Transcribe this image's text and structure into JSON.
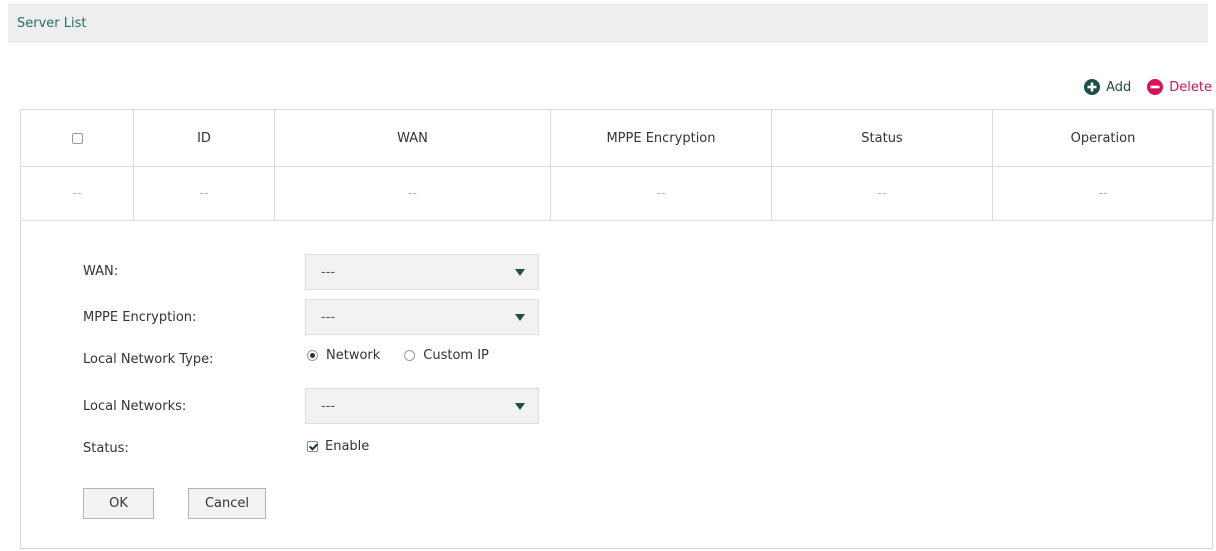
{
  "section": {
    "title": "Server List"
  },
  "toolbar": {
    "add_label": "Add",
    "delete_label": "Delete"
  },
  "table": {
    "columns": [
      "",
      "ID",
      "WAN",
      "MPPE Encryption",
      "Status",
      "Operation"
    ],
    "rows": [
      [
        "--",
        "--",
        "--",
        "--",
        "--",
        "--"
      ]
    ]
  },
  "form": {
    "wan": {
      "label": "WAN:",
      "value": "---"
    },
    "mppe": {
      "label": "MPPE Encryption:",
      "value": "---"
    },
    "local_network_type": {
      "label": "Local Network Type:",
      "options": [
        "Network",
        "Custom IP"
      ],
      "selected": "Network"
    },
    "local_networks": {
      "label": "Local Networks:",
      "value": "---"
    },
    "status": {
      "label": "Status:",
      "checkbox_label": "Enable",
      "checked": true
    },
    "ok_label": "OK",
    "cancel_label": "Cancel"
  },
  "colors": {
    "header_bg": "#eeeeee",
    "header_text": "#1f6f6a",
    "add_icon": "#1b4f4a",
    "delete_icon": "#d4145a"
  },
  "icons": {
    "add": "plus-circle-icon",
    "delete": "minus-circle-icon",
    "dropdown": "caret-down-icon"
  }
}
